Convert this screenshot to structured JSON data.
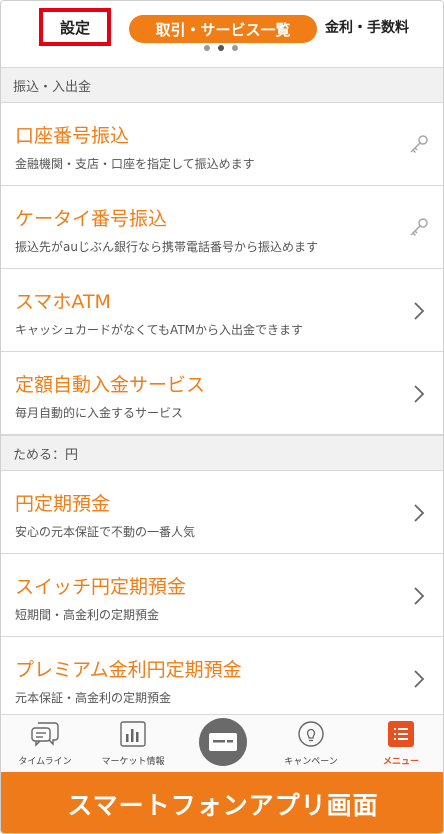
{
  "topbar": {
    "tab_settings": "設定",
    "tab_services": "取引・サービス一覧",
    "tab_rates": "金利・手数料"
  },
  "sections": [
    {
      "header": "振込・入出金",
      "items": [
        {
          "title": "口座番号振込",
          "desc": "金融機関・支店・口座を指定して振込めます",
          "icon": "key-icon"
        },
        {
          "title": "ケータイ番号振込",
          "desc": "振込先がauじぶん銀行なら携帯電話番号から振込めます",
          "icon": "key-icon"
        },
        {
          "title": "スマホATM",
          "desc": "キャッシュカードがなくてもATMから入出金できます",
          "icon": "chevron-right-icon"
        },
        {
          "title": "定額自動入金サービス",
          "desc": "毎月自動的に入金するサービス",
          "icon": "chevron-right-icon"
        }
      ]
    },
    {
      "header": "ためる：円",
      "items": [
        {
          "title": "円定期預金",
          "desc": "安心の元本保証で不動の一番人気",
          "icon": "chevron-right-icon"
        },
        {
          "title": "スイッチ円定期預金",
          "desc": "短期間・高金利の定期預金",
          "icon": "chevron-right-icon"
        },
        {
          "title": "プレミアム金利円定期預金",
          "desc": "元本保証・高金利の定期預金",
          "icon": "chevron-right-icon"
        }
      ]
    }
  ],
  "bottomnav": {
    "timeline": "タイムライン",
    "market": "マーケット情報",
    "campaign": "キャンペーン",
    "menu": "メニュー"
  },
  "banner": "スマートフォンアプリ画面",
  "colors": {
    "accent": "#f07d16",
    "highlight_border": "#e60012",
    "menu_active": "#e8501f"
  }
}
